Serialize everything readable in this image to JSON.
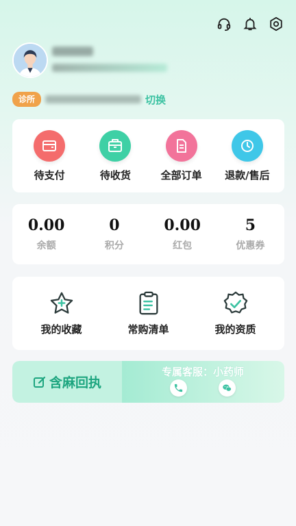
{
  "header": {
    "icons": [
      "headset-icon",
      "bell-icon",
      "settings-icon"
    ]
  },
  "clinic": {
    "badge": "诊所",
    "switch_label": "切换"
  },
  "orders": [
    {
      "label": "待支付",
      "icon": "wallet-icon",
      "color": "#f46c6c"
    },
    {
      "label": "待收货",
      "icon": "package-icon",
      "color": "#3ed0a5"
    },
    {
      "label": "全部订单",
      "icon": "document-icon",
      "color": "#f2739a"
    },
    {
      "label": "退款/售后",
      "icon": "clock-icon",
      "color": "#3fc7e8"
    }
  ],
  "wallet": [
    {
      "value": "0.00",
      "label": "余额"
    },
    {
      "value": "0",
      "label": "积分"
    },
    {
      "value": "0.00",
      "label": "红包"
    },
    {
      "value": "5",
      "label": "优惠券"
    }
  ],
  "tools": [
    {
      "label": "我的收藏",
      "icon": "star-icon"
    },
    {
      "label": "常购清单",
      "icon": "clipboard-icon"
    },
    {
      "label": "我的资质",
      "icon": "badge-check-icon"
    }
  ],
  "service": {
    "left_label": "含麻回执",
    "title": "专属客服：小药师"
  },
  "colors": {
    "accent": "#3cc2a2",
    "badge": "#f0a24a"
  }
}
